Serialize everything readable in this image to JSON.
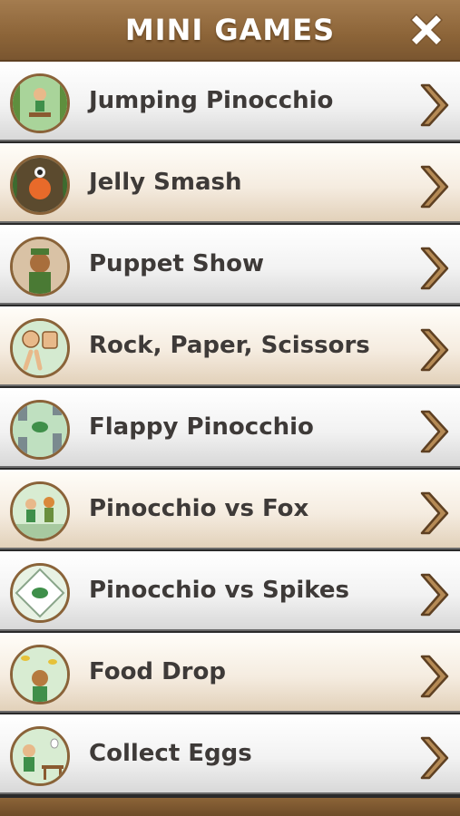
{
  "header": {
    "title": "MINI GAMES",
    "close_icon": "close-x-icon"
  },
  "games": [
    {
      "label": "Jumping Pinocchio",
      "icon": "jumping-pinocchio-thumbnail"
    },
    {
      "label": "Jelly Smash",
      "icon": "jelly-smash-thumbnail"
    },
    {
      "label": "Puppet Show",
      "icon": "puppet-show-thumbnail"
    },
    {
      "label": "Rock, Paper, Scissors",
      "icon": "rock-paper-scissors-thumbnail"
    },
    {
      "label": "Flappy Pinocchio",
      "icon": "flappy-pinocchio-thumbnail"
    },
    {
      "label": "Pinocchio vs Fox",
      "icon": "pinocchio-vs-fox-thumbnail"
    },
    {
      "label": "Pinocchio vs Spikes",
      "icon": "pinocchio-vs-spikes-thumbnail"
    },
    {
      "label": "Food Drop",
      "icon": "food-drop-thumbnail"
    },
    {
      "label": "Collect Eggs",
      "icon": "collect-eggs-thumbnail"
    }
  ],
  "colors": {
    "header_brown": "#8c6438",
    "thumb_border": "#8a6339",
    "chevron_fill": "#b58a55",
    "label_text": "#3e3a38"
  }
}
